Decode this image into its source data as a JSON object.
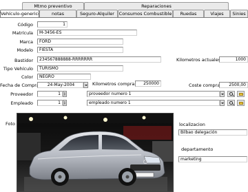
{
  "tabs_row1": [
    {
      "label": "Mtmo preventivo"
    },
    {
      "label": "Reparaciones"
    }
  ],
  "tabs_row2": [
    {
      "label": "Vehículo-genericos",
      "active": true
    },
    {
      "label": "notas"
    },
    {
      "label": "Seguro-Alquiler"
    },
    {
      "label": "Consumos Combustible"
    },
    {
      "label": "Ruedas"
    },
    {
      "label": "Viajes"
    },
    {
      "label": "Sinies"
    }
  ],
  "form": {
    "codigo_label": "Código",
    "codigo_value": "1",
    "matricula_label": "Matrícula",
    "matricula_value": "M-3456-ES",
    "marca_label": "Marca",
    "marca_value": "FORD",
    "modelo_label": "Modelo",
    "modelo_value": "FIESTA",
    "bastidor_label": "Bastidor",
    "bastidor_value": "234567888888-RRRRRRR",
    "km_actuales_label": "Kilometros actuales",
    "km_actuales_value": "1000",
    "tipo_label": "Tipo Vehículo",
    "tipo_value": "TURISMO",
    "color_label": "Color",
    "color_value": "NEGRO",
    "fecha_compra_label": "Fecha de Compra",
    "fecha_compra_value": "24-May-2004",
    "km_compra_label": "Kilometros compra",
    "km_compra_value": "250000",
    "coste_compra_label": "Coste compra",
    "coste_compra_value": "2500,00",
    "proveedor_label": "Proveedor",
    "proveedor_code": "1",
    "proveedor_name": "proveedor numero 1",
    "empleado_label": "Empleado",
    "empleado_code": "1",
    "empleado_name": "empleado numero 1",
    "foto_label": "Foto",
    "localizacion_label": "localizacion",
    "localizacion_value": "Bilbao delegación",
    "departamento_label": "departamento",
    "departamento_value": "marketing"
  },
  "colors": {
    "field_border": "#8a8a8a",
    "tab_inactive": "#eaeaea",
    "car_silver": "#b8bcc4",
    "folder_yellow": "#e8c43c"
  }
}
